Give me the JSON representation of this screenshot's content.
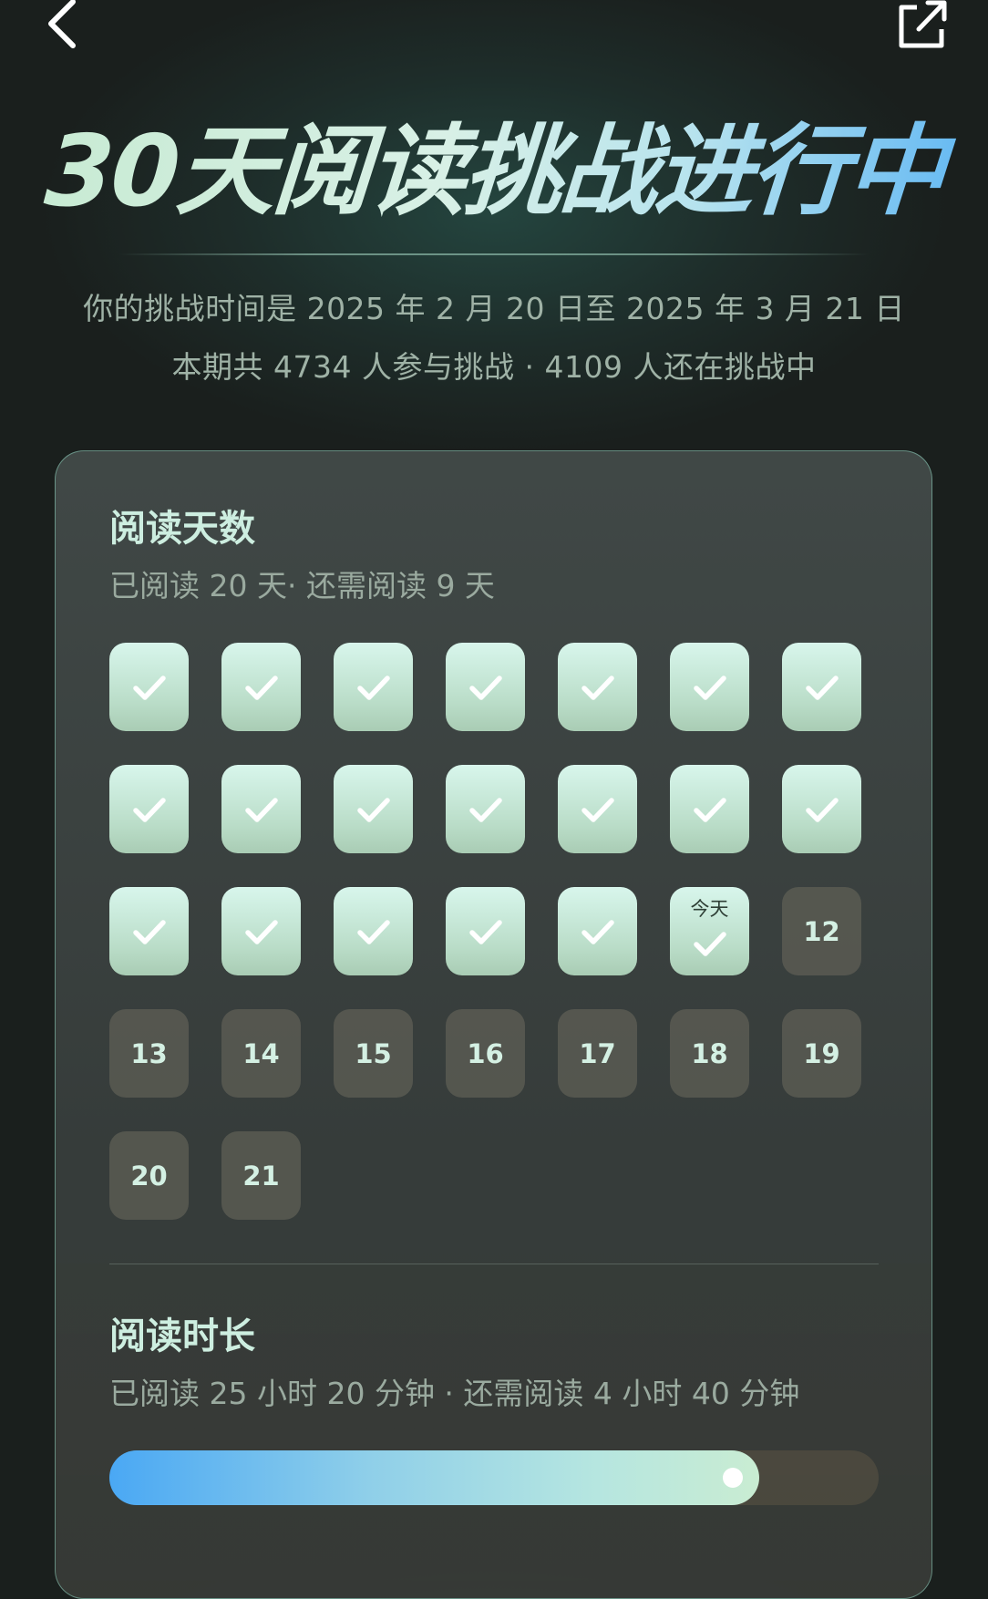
{
  "header": {
    "back_icon": "chevron-left-icon",
    "share_icon": "share-external-icon"
  },
  "title": "30天阅读挑战进行中",
  "subtitle_period": "你的挑战时间是 2025 年 2 月 20 日至 2025 年 3 月 21 日",
  "subtitle_participants": "本期共 4734 人参与挑战 · 4109 人还在挑战中",
  "reading_days": {
    "title": "阅读天数",
    "summary": "已阅读 20 天· 还需阅读 9 天",
    "today_label": "今天",
    "cells": [
      {
        "state": "done"
      },
      {
        "state": "done"
      },
      {
        "state": "done"
      },
      {
        "state": "done"
      },
      {
        "state": "done"
      },
      {
        "state": "done"
      },
      {
        "state": "done"
      },
      {
        "state": "done"
      },
      {
        "state": "done"
      },
      {
        "state": "done"
      },
      {
        "state": "done"
      },
      {
        "state": "done"
      },
      {
        "state": "done"
      },
      {
        "state": "done"
      },
      {
        "state": "done"
      },
      {
        "state": "done"
      },
      {
        "state": "done"
      },
      {
        "state": "done"
      },
      {
        "state": "done"
      },
      {
        "state": "today"
      },
      {
        "state": "todo",
        "label": "12"
      },
      {
        "state": "todo",
        "label": "13"
      },
      {
        "state": "todo",
        "label": "14"
      },
      {
        "state": "todo",
        "label": "15"
      },
      {
        "state": "todo",
        "label": "16"
      },
      {
        "state": "todo",
        "label": "17"
      },
      {
        "state": "todo",
        "label": "18"
      },
      {
        "state": "todo",
        "label": "19"
      },
      {
        "state": "todo",
        "label": "20"
      },
      {
        "state": "todo",
        "label": "21"
      }
    ]
  },
  "reading_time": {
    "title": "阅读时长",
    "summary": "已阅读 25 小时 20 分钟 · 还需阅读 4 小时 40 分钟",
    "progress": 0.845
  },
  "colors": {
    "done_cell": "#c8eadb",
    "todo_cell": "#5f5f56",
    "progress_start": "#4aa8f4",
    "progress_end": "#c9ecd2"
  }
}
